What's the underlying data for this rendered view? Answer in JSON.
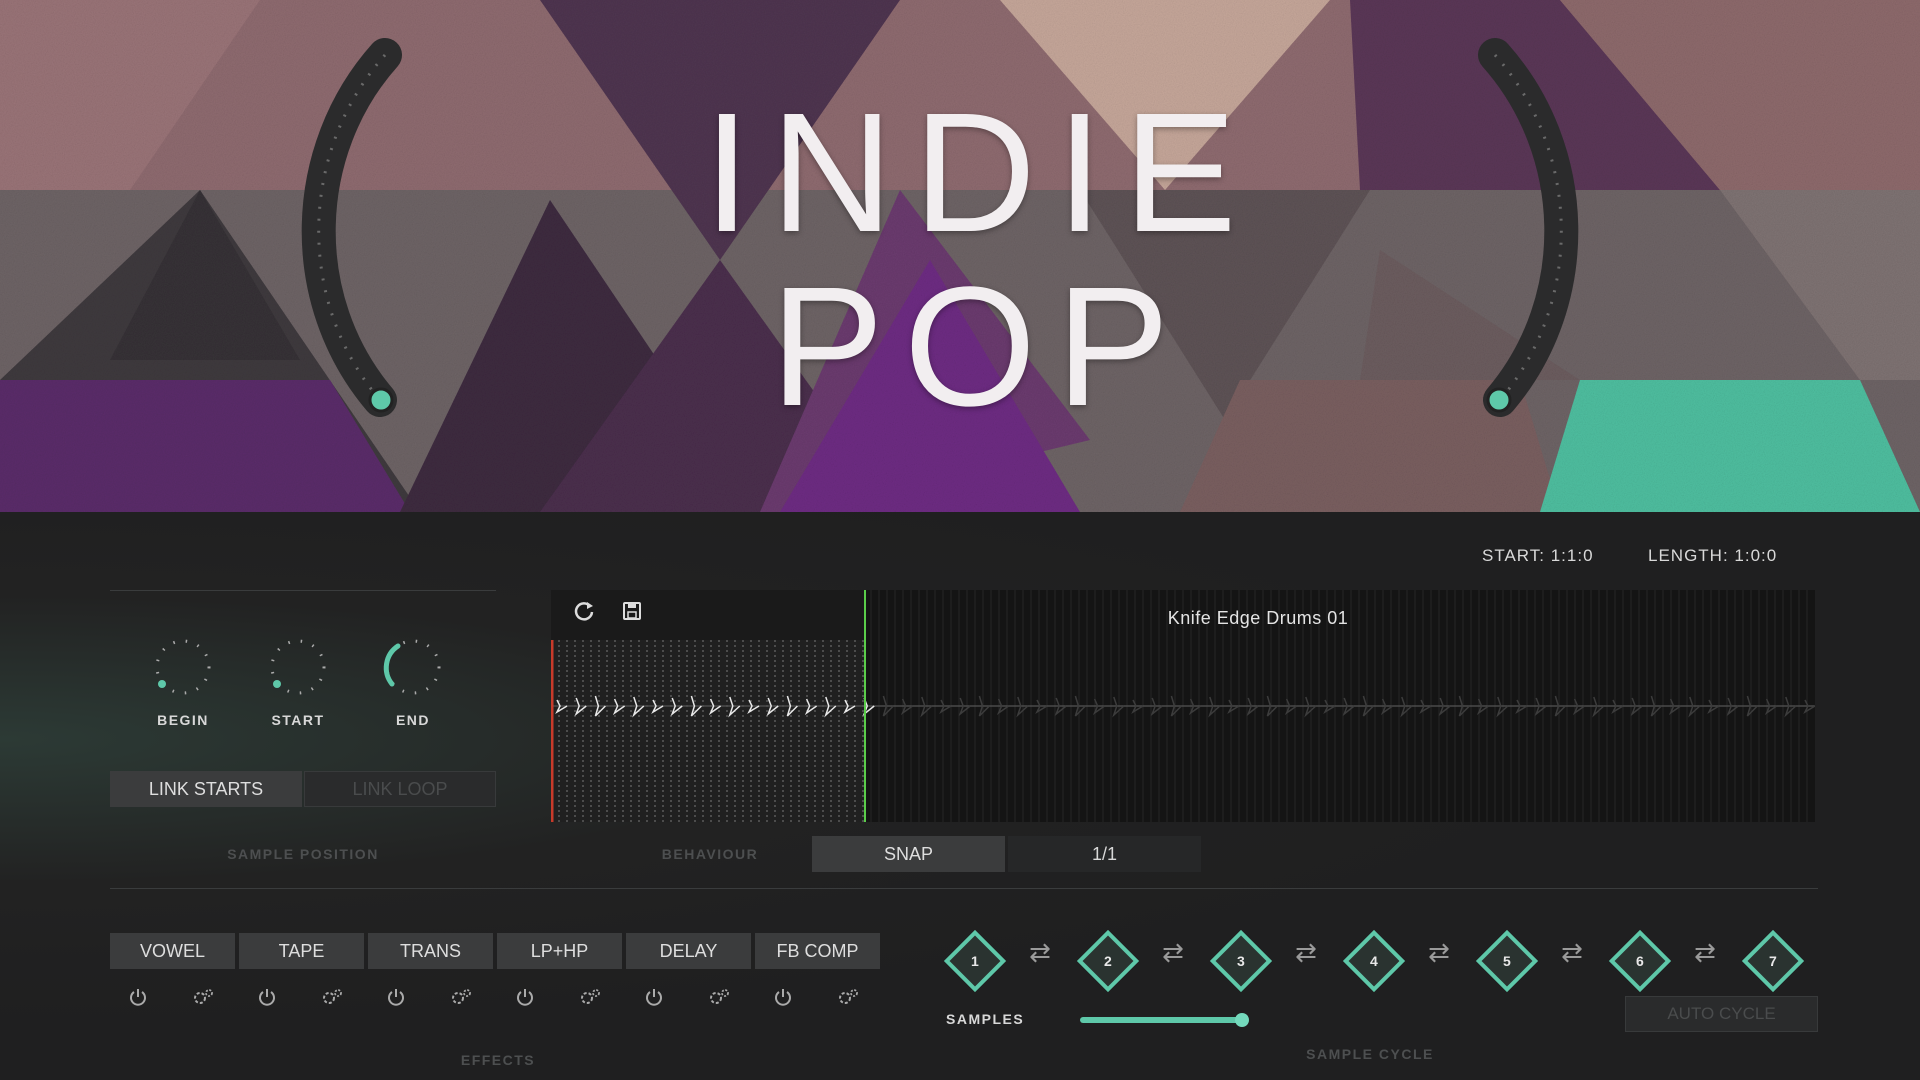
{
  "hero": {
    "title_line1": "INDIE",
    "title_line2": "POP"
  },
  "colors": {
    "accent": "#5ec8a9",
    "panel_bg": "#1f1f20",
    "button_bg": "#3b3c3d",
    "playhead_red": "#c83a2a",
    "loop_green": "#5acd4a"
  },
  "transport": {
    "start_label": "START: 1:1:0",
    "length_label": "LENGTH: 1:0:0"
  },
  "sample_position": {
    "knobs": [
      {
        "label": "BEGIN",
        "icon": "knob-icon"
      },
      {
        "label": "START",
        "icon": "knob-icon"
      },
      {
        "label": "END",
        "icon": "knob-icon"
      }
    ],
    "link_starts": "LINK STARTS",
    "link_loop": "LINK LOOP",
    "section_label": "SAMPLE POSITION"
  },
  "waveform": {
    "sample_name": "Knife Edge Drums 01",
    "refresh_icon": "refresh-icon",
    "save_icon": "save-icon"
  },
  "behaviour": {
    "label": "BEHAVIOUR",
    "snap": "SNAP",
    "division": "1/1"
  },
  "effects": {
    "label": "EFFECTS",
    "items": [
      "VOWEL",
      "TAPE",
      "TRANS",
      "LP+HP",
      "DELAY",
      "FB COMP"
    ],
    "power_icon": "power-icon",
    "settings_icon": "settings-icon"
  },
  "sample_cycle": {
    "label": "SAMPLE CYCLE",
    "slots": [
      "1",
      "2",
      "3",
      "4",
      "5",
      "6",
      "7"
    ],
    "swap_icon": "swap-icon",
    "samples_label": "SAMPLES",
    "samples_value": 1.0,
    "auto_cycle": "AUTO CYCLE"
  }
}
